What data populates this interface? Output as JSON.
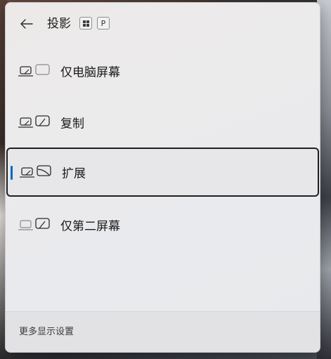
{
  "header": {
    "title": "投影",
    "shortcut_win_icon": "windows-key-icon",
    "shortcut_key": "P",
    "back_icon": "back-arrow-icon"
  },
  "options": [
    {
      "label": "仅电脑屏幕",
      "icon": "pc-screen-only-icon",
      "selected": false
    },
    {
      "label": "复制",
      "icon": "duplicate-icon",
      "selected": false
    },
    {
      "label": "扩展",
      "icon": "extend-icon",
      "selected": true
    },
    {
      "label": "仅第二屏幕",
      "icon": "second-screen-only-icon",
      "selected": false
    }
  ],
  "footer": {
    "link": "更多显示设置"
  },
  "colors": {
    "accent": "#0067c0",
    "text": "#1b1b1b",
    "panel": "#ecebec"
  }
}
